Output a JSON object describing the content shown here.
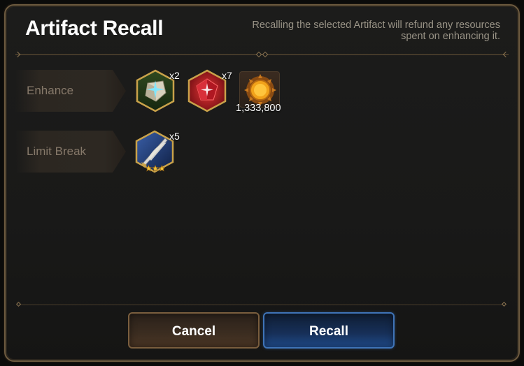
{
  "dialog": {
    "title": "Artifact Recall",
    "description": "Recalling the selected Artifact will refund any resources spent on enhancing it."
  },
  "rows": {
    "enhance": {
      "label": "Enhance",
      "items": [
        {
          "icon": "enhance-stone-icon",
          "quantity": "x2"
        },
        {
          "icon": "red-gem-icon",
          "quantity": "x7"
        },
        {
          "icon": "gold-coin-icon",
          "quantity": "1,333,800"
        }
      ]
    },
    "limit_break": {
      "label": "Limit Break",
      "items": [
        {
          "icon": "artifact-feather-sword-icon",
          "quantity": "x5",
          "stars": 3
        }
      ]
    }
  },
  "buttons": {
    "cancel": "Cancel",
    "recall": "Recall"
  },
  "colors": {
    "cancel_border": "#7a5e3e",
    "recall_border": "#3f74b8",
    "frame_border": "#6d5a3f"
  }
}
